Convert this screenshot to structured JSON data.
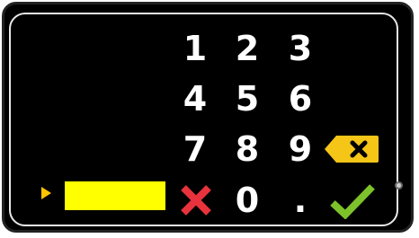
{
  "keypad": {
    "row1": [
      "1",
      "2",
      "3"
    ],
    "row2": [
      "4",
      "5",
      "6"
    ],
    "row3": [
      "7",
      "8",
      "9"
    ],
    "zero": "0",
    "decimal": "."
  },
  "entry": {
    "value": ""
  },
  "icons": {
    "backspace": "backspace-icon",
    "cancel": "cancel-icon",
    "confirm": "checkmark-icon",
    "entry_pointer": "triangle-right-icon"
  },
  "colors": {
    "background": "#000000",
    "digits": "#ffffff",
    "entry_field": "#ffff00",
    "pointer": "#ffc400",
    "backspace": "#f5c518",
    "cancel": "#e8333c",
    "confirm": "#7dc22b"
  }
}
